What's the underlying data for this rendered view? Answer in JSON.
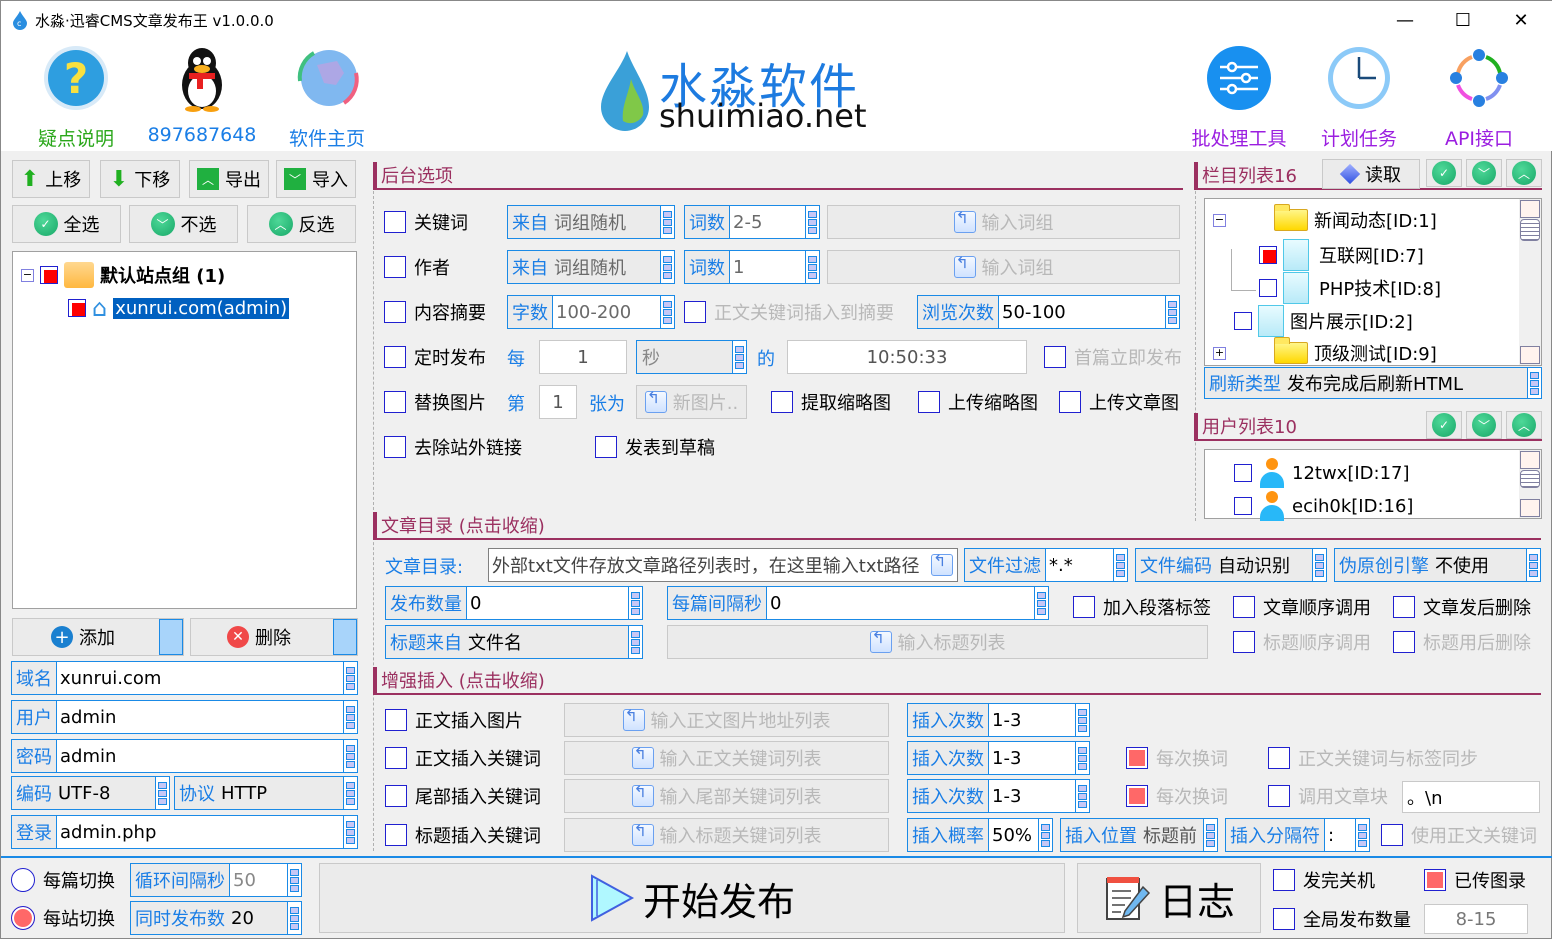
{
  "window": {
    "title": "水淼·迅睿CMS文章发布王 v1.0.0.0",
    "minimize": "—",
    "maximize": "☐",
    "close": "✕"
  },
  "header": {
    "left_items": [
      {
        "label": "疑点说明",
        "icon": "help-icon"
      },
      {
        "label": "897687648",
        "icon": "qq-penguin-icon"
      },
      {
        "label": "软件主页",
        "icon": "globe-icon"
      }
    ],
    "logo": {
      "cn": "水淼软件",
      "en": "shuimiao.net"
    },
    "right_items": [
      {
        "label": "批处理工具",
        "icon": "sliders-icon"
      },
      {
        "label": "计划任务",
        "icon": "clock-icon"
      },
      {
        "label": "API接口",
        "icon": "api-ring-icon"
      }
    ]
  },
  "left": {
    "toolbar1": [
      "上移",
      "下移",
      "导出",
      "导入"
    ],
    "toolbar2": [
      "全选",
      "不选",
      "反选"
    ],
    "tree": {
      "group": "默认站点组 (1)",
      "site": "xunrui.com(admin)"
    },
    "add": "添加",
    "delete": "删除",
    "fields": {
      "domain": {
        "label": "域名",
        "value": "xunrui.com"
      },
      "user": {
        "label": "用户",
        "value": "admin"
      },
      "password": {
        "label": "密码",
        "value": "admin"
      },
      "encoding": {
        "label": "编码",
        "value": "UTF-8"
      },
      "protocol": {
        "label": "协议",
        "value": "HTTP"
      },
      "login": {
        "label": "登录",
        "value": "admin.php"
      }
    }
  },
  "backend": {
    "title": "后台选项",
    "keyword": {
      "label": "关键词",
      "from_label": "来自",
      "from_value": "词组随机",
      "count_label": "词数",
      "count_value": "2-5",
      "input_btn": "输入词组"
    },
    "author": {
      "label": "作者",
      "from_label": "来自",
      "from_value": "词组随机",
      "count_label": "词数",
      "count_value": "1",
      "input_btn": "输入词组"
    },
    "summary": {
      "label": "内容摘要",
      "chars_label": "字数",
      "chars_value": "100-200",
      "kw_insert": "正文关键词插入到摘要",
      "views_label": "浏览次数",
      "views_value": "50-100"
    },
    "timed": {
      "label": "定时发布",
      "every": "每",
      "every_value": "1",
      "unit": "秒",
      "of": "的",
      "time": "10:50:33",
      "first_now": "首篇立即发布"
    },
    "replace_img": {
      "label": "替换图片",
      "nth": "第",
      "nth_value": "1",
      "as": "张为",
      "new_img": "新图片..",
      "extract_thumb": "提取缩略图",
      "upload_thumb": "上传缩略图",
      "upload_img": "上传文章图"
    },
    "remove_links": "去除站外链接",
    "draft": "发表到草稿"
  },
  "categories": {
    "title": "栏目列表16",
    "read_btn": "读取",
    "items": [
      {
        "label": "新闻动态[ID:1]",
        "type": "folder",
        "expander": "−"
      },
      {
        "label": "互联网[ID:7]",
        "type": "doc",
        "checked": true
      },
      {
        "label": "PHP技术[ID:8]",
        "type": "doc",
        "checked": false
      },
      {
        "label": "图片展示[ID:2]",
        "type": "doc",
        "checked": false
      },
      {
        "label": "顶级测试[ID:9]",
        "type": "folder",
        "expander": "+"
      }
    ],
    "refresh_label": "刷新类型",
    "refresh_value": "发布完成后刷新HTML"
  },
  "users": {
    "title": "用户列表10",
    "items": [
      "12twx[ID:17]",
      "ecih0k[ID:16]"
    ]
  },
  "articles": {
    "title": "文章目录 (点击收缩)",
    "dir_label": "文章目录:",
    "dir_placeholder": "外部txt文件存放文章路径列表时，在这里输入txt路径",
    "filter_label": "文件过滤",
    "filter_value": "*.*",
    "enc_label": "文件编码",
    "enc_value": "自动识别",
    "pseudo_label": "伪原创引擎",
    "pseudo_value": "不使用",
    "count_label": "发布数量",
    "count_value": "0",
    "interval_label": "每篇间隔秒",
    "interval_value": "0",
    "add_para": "加入段落标签",
    "order_call": "文章顺序调用",
    "delete_after": "文章发后删除",
    "title_from_label": "标题来自",
    "title_from_value": "文件名",
    "title_list_btn": "输入标题列表",
    "title_order": "标题顺序调用",
    "title_delete": "标题用后删除"
  },
  "enhance": {
    "title": "增强插入 (点击收缩)",
    "rows": [
      {
        "label": "正文插入图片",
        "btn": "输入正文图片地址列表",
        "times_label": "插入次数",
        "times_value": "1-3"
      },
      {
        "label": "正文插入关键词",
        "btn": "输入正文关键词列表",
        "times_label": "插入次数",
        "times_value": "1-3",
        "swap": "每次换词",
        "sync": "正文关键词与标签同步"
      },
      {
        "label": "尾部插入关键词",
        "btn": "输入尾部关键词列表",
        "times_label": "插入次数",
        "times_value": "1-3",
        "swap": "每次换词",
        "block": "调用文章块",
        "block_value": "。\\n"
      },
      {
        "label": "标题插入关键词",
        "btn": "输入标题关键词列表"
      }
    ],
    "prob_label": "插入概率",
    "prob_value": "50%",
    "pos_label": "插入位置",
    "pos_value": "标题前",
    "sep_label": "插入分隔符",
    "sep_value": ":",
    "use_body_kw": "使用正文关键词"
  },
  "bottom": {
    "per_article": "每篇切换",
    "per_site": "每站切换",
    "loop_label": "循环间隔秒",
    "loop_value": "50",
    "concurrent_label": "同时发布数",
    "concurrent_value": "20",
    "start": "开始发布",
    "log": "日志",
    "shutdown": "发完关机",
    "uploaded_log": "已传图录",
    "global_count": "全局发布数量",
    "global_value": "8-15"
  }
}
